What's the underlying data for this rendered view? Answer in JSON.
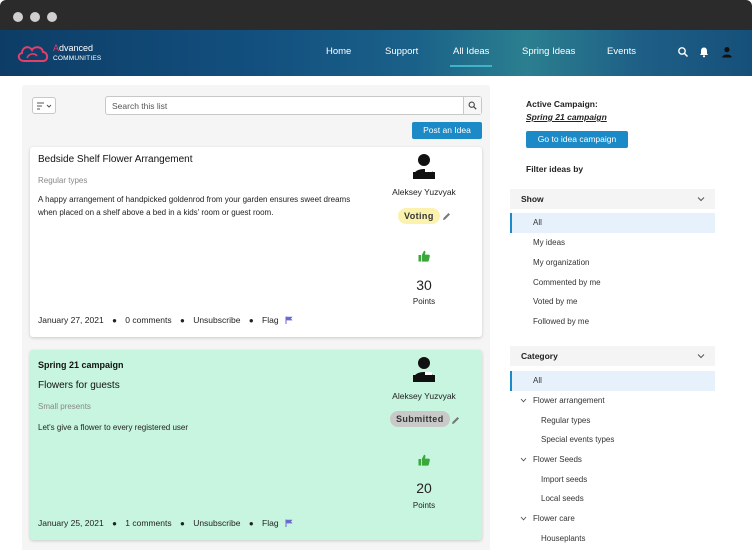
{
  "app": {
    "logo_accent": "A",
    "logo_rest": "dvanced",
    "logo_sub": "COMMUNITIES"
  },
  "nav": {
    "items": [
      "Home",
      "Support",
      "All Ideas",
      "Spring Ideas",
      "Events"
    ],
    "active": "All Ideas"
  },
  "toolbar": {
    "search_placeholder": "Search this list",
    "post_button": "Post an Idea"
  },
  "ideas": [
    {
      "campaign": "",
      "title": "Bedside Shelf Flower Arrangement",
      "type": "Regular types",
      "description": "A happy arrangement of handpicked goldenrod from your garden ensures sweet dreams when placed on a shelf above a bed in a kids' room or guest room.",
      "author": "Aleksey Yuzvyak",
      "status": "Voting",
      "points": 30,
      "points_label": "Points",
      "date": "January 27, 2021",
      "comments": "0  comments",
      "unsubscribe": "Unsubscribe",
      "flag": "Flag"
    },
    {
      "campaign": "Spring 21 campaign",
      "title": "Flowers for guests",
      "type": "Small presents",
      "description": "Let's give a flower to every registered user",
      "author": "Aleksey Yuzvyak",
      "status": "Submitted",
      "points": 20,
      "points_label": "Points",
      "date": "January 25, 2021",
      "comments": "1  comments",
      "unsubscribe": "Unsubscribe",
      "flag": "Flag"
    }
  ],
  "sidebar": {
    "active_campaign_label": "Active Campaign:",
    "active_campaign_name": "Spring 21 campaign",
    "goto_button": "Go to idea campaign",
    "filter_label": "Filter ideas by",
    "show": {
      "heading": "Show",
      "options": [
        "All",
        "My ideas",
        "My organization",
        "Commented by me",
        "Voted by me",
        "Followed by me"
      ],
      "selected": "All"
    },
    "category": {
      "heading": "Category",
      "selected": "All",
      "items": [
        {
          "label": "All",
          "level": 0
        },
        {
          "label": "Flower arrangement",
          "level": 1
        },
        {
          "label": "Regular types",
          "level": 2
        },
        {
          "label": "Special events types",
          "level": 2
        },
        {
          "label": "Flower Seeds",
          "level": 1
        },
        {
          "label": "Import seeds",
          "level": 2
        },
        {
          "label": "Local seeds",
          "level": 2
        },
        {
          "label": "Flower care",
          "level": 1
        },
        {
          "label": "Houseplants",
          "level": 2
        }
      ]
    }
  },
  "colors": {
    "primary_button": "#1b8ac6",
    "campaign_card": "#c8f5df",
    "voting_badge": "#fbf2ad",
    "submitted_badge": "#c9c9c9",
    "thumb_up": "#3aa83a",
    "logo_accent": "#e23f6a"
  }
}
